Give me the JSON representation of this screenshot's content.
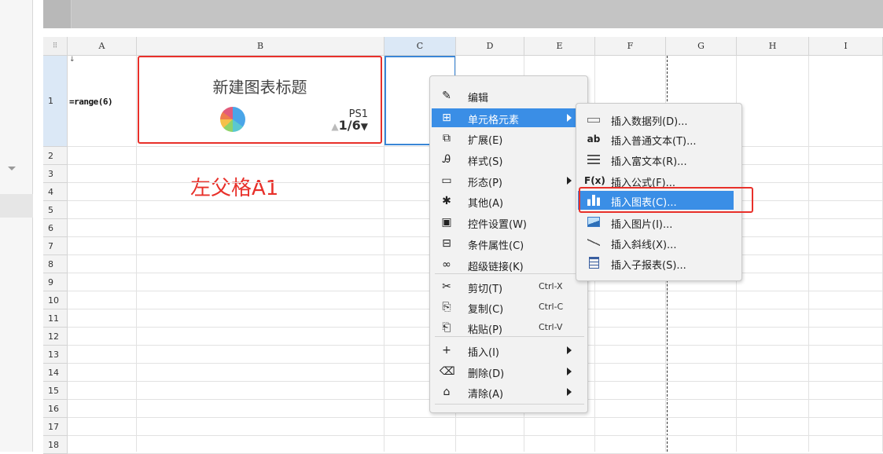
{
  "columns": [
    "A",
    "B",
    "C",
    "D",
    "E",
    "F",
    "G",
    "H",
    "I"
  ],
  "rows": [
    "1",
    "2",
    "3",
    "4",
    "5",
    "6",
    "7",
    "8",
    "9",
    "10",
    "11",
    "12",
    "13",
    "14",
    "15",
    "16",
    "17",
    "18"
  ],
  "corner_glyph": "⠿",
  "cells": {
    "A1": "=range(6)"
  },
  "chart": {
    "title": "新建图表标题",
    "series_tag": "PS1",
    "pager": "1/6"
  },
  "annotation": "左父格A1",
  "context_menu": {
    "items": [
      {
        "label": "编辑",
        "icon": "pencil-icon"
      },
      {
        "label": "单元格元素",
        "icon": "table-icon",
        "submenu": true,
        "highlighted": true
      },
      {
        "label": "扩展(E)",
        "icon": "expand-icon"
      },
      {
        "label": "样式(S)",
        "icon": "style-icon"
      },
      {
        "label": "形态(P)",
        "icon": "shape-icon",
        "submenu": true
      },
      {
        "label": "其他(A)",
        "icon": "gear-icon"
      },
      {
        "label": "控件设置(W)",
        "icon": "widget-icon"
      },
      {
        "label": "条件属性(C)",
        "icon": "condition-icon"
      },
      {
        "label": "超级链接(K)",
        "icon": "link-icon"
      },
      {
        "label": "剪切(T)",
        "icon": "scissors-icon",
        "shortcut": "Ctrl-X"
      },
      {
        "label": "复制(C)",
        "icon": "copy-icon",
        "shortcut": "Ctrl-C"
      },
      {
        "label": "粘贴(P)",
        "icon": "paste-icon",
        "shortcut": "Ctrl-V"
      },
      {
        "label": "插入(I)",
        "icon": "plus-icon",
        "submenu": true
      },
      {
        "label": "删除(D)",
        "icon": "trash-icon",
        "submenu": true
      },
      {
        "label": "清除(A)",
        "icon": "eraser-icon",
        "submenu": true
      }
    ]
  },
  "submenu": {
    "items": [
      {
        "label": "插入数据列(D)...",
        "icon": "datacolumn-icon",
        "glyph": ""
      },
      {
        "label": "插入普通文本(T)...",
        "icon": "text-icon",
        "glyph": "ab"
      },
      {
        "label": "插入富文本(R)...",
        "icon": "richtext-icon",
        "glyph": ""
      },
      {
        "label": "插入公式(F)...",
        "icon": "formula-icon",
        "glyph": "F(x)"
      },
      {
        "label": "插入图表(C)...",
        "icon": "bar-chart-icon",
        "glyph": "",
        "highlighted": true
      },
      {
        "label": "插入图片(I)...",
        "icon": "image-icon",
        "glyph": ""
      },
      {
        "label": "插入斜线(X)...",
        "icon": "slash-icon",
        "glyph": ""
      },
      {
        "label": "插入子报表(S)...",
        "icon": "subreport-icon",
        "glyph": ""
      }
    ]
  },
  "icon_glyphs": {
    "pencil": "✎",
    "table": "⊞",
    "expand": "⧉",
    "style": "Ꭿ",
    "shape": "▭",
    "gear": "✱",
    "widget": "▣",
    "condition": "⊟",
    "link": "∞",
    "scissors": "✂",
    "copy": "⎘",
    "paste": "⎗",
    "plus": "+",
    "trash": "⌫",
    "eraser": "⌂",
    "sub_arrow": "▶",
    "pager_down": "▼",
    "pager_up": "▲"
  },
  "colors": {
    "highlight": "#3a8ee6",
    "annotation_red": "#e8302a",
    "selection_blue": "#3a86d6"
  }
}
